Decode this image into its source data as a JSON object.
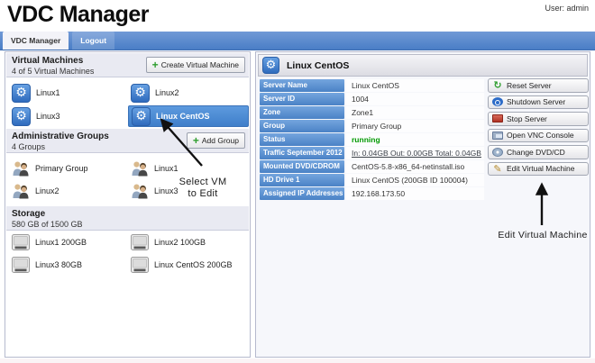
{
  "header": {
    "app_title": "VDC Manager",
    "user_label": "User: admin"
  },
  "tabs": [
    {
      "label": "VDC Manager",
      "active": true
    },
    {
      "label": "Logout",
      "active": false
    }
  ],
  "left_panel": {
    "vm_section": {
      "title": "Virtual Machines",
      "subtitle": "4 of 5 Virtual Machines",
      "create_button_label": "Create Virtual Machine",
      "items": [
        {
          "name": "vm-item-linux1",
          "label": "Linux1"
        },
        {
          "name": "vm-item-linux2",
          "label": "Linux2"
        },
        {
          "name": "vm-item-linux3",
          "label": "Linux3"
        },
        {
          "name": "vm-item-linux-centos",
          "label": "Linux CentOS",
          "selected": true
        }
      ]
    },
    "groups_section": {
      "title": "Administrative Groups",
      "subtitle": "4 Groups",
      "add_button_label": "Add Group",
      "items": [
        {
          "name": "group-item-primary-group",
          "label": "Primary Group"
        },
        {
          "name": "group-item-linux1",
          "label": "Linux1"
        },
        {
          "name": "group-item-linux2",
          "label": "Linux2"
        },
        {
          "name": "group-item-linux3",
          "label": "Linux3"
        }
      ]
    },
    "storage_section": {
      "title": "Storage",
      "subtitle": "580 GB of 1500 GB",
      "items": [
        {
          "name": "storage-item-linux1",
          "label": "Linux1 200GB"
        },
        {
          "name": "storage-item-linux2",
          "label": "Linux2 100GB"
        },
        {
          "name": "storage-item-linux3",
          "label": "Linux3 80GB"
        },
        {
          "name": "storage-item-linux-centos",
          "label": "Linux CentOS 200GB"
        }
      ]
    }
  },
  "right_panel": {
    "title": "Linux CentOS",
    "details": [
      {
        "label": "Server Name",
        "value": "Linux CentOS"
      },
      {
        "label": "Server ID",
        "value": "1004"
      },
      {
        "label": "Zone",
        "value": "Zone1"
      },
      {
        "label": "Group",
        "value": "Primary Group"
      },
      {
        "label": "Status",
        "value": "running",
        "style": "status-running"
      },
      {
        "label": "Traffic September 2012",
        "value": "In: 0.04GB Out: 0.00GB Total: 0.04GB",
        "style": "traffic-link"
      },
      {
        "label": "Mounted DVD/CDROM",
        "value": "CentOS-5.8-x86_64-netinstall.iso"
      },
      {
        "label": "HD Drive 1",
        "value": "Linux CentOS (200GB ID 100004)"
      },
      {
        "label": "Assigned IP Addresses",
        "value": "192.168.173.50"
      }
    ],
    "actions": [
      {
        "name": "reset-server-button",
        "label": "Reset Server",
        "icon": "reset"
      },
      {
        "name": "shutdown-server-button",
        "label": "Shutdown Server",
        "icon": "shutdown"
      },
      {
        "name": "stop-server-button",
        "label": "Stop Server",
        "icon": "stop"
      },
      {
        "name": "open-vnc-console-button",
        "label": "Open VNC Console",
        "icon": "vnc"
      },
      {
        "name": "change-dvd-button",
        "label": "Change DVD/CD",
        "icon": "dvd"
      },
      {
        "name": "edit-virtual-machine-button",
        "label": "Edit Virtual Machine",
        "icon": "edit"
      }
    ]
  },
  "annotations": {
    "select_vm_line1": "Select VM",
    "select_vm_line2": "to Edit",
    "edit_vm": "Edit Virtual Machine"
  },
  "colors": {
    "accent_blue": "#4a8ed8",
    "tab_bar_blue": "#5b8cd0",
    "status_green": "#009900",
    "plus_green": "#2e9e2e"
  }
}
